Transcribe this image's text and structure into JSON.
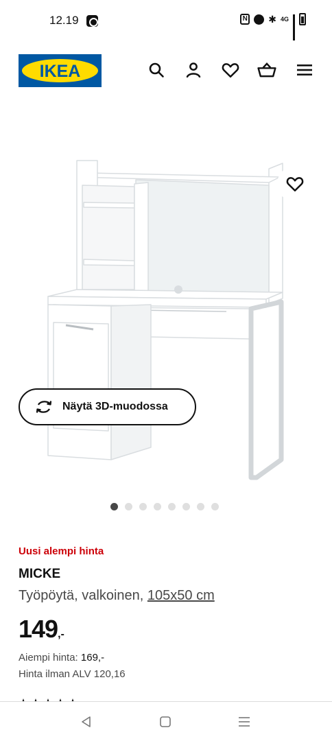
{
  "status_bar": {
    "time": "12.19",
    "network_label": "4G",
    "icons": [
      "app-notification-icon",
      "nfc-icon",
      "alarm-icon",
      "bluetooth-icon",
      "signal-icon",
      "battery-icon"
    ]
  },
  "header": {
    "logo_text": "IKEA",
    "icons": [
      "search-icon",
      "account-icon",
      "favourites-icon",
      "shopping-bag-icon",
      "menu-icon"
    ]
  },
  "gallery": {
    "view_3d_label": "Näytä 3D-muodossa",
    "dot_count": 8,
    "active_dot": 0
  },
  "product": {
    "badge": "Uusi alempi hinta",
    "name": "MICKE",
    "description": "Työpöytä, valkoinen, ",
    "size": "105x50 cm",
    "price_integer": "149",
    "price_decimal": ",-",
    "previous_price_label": "Aiempi hinta: ",
    "previous_price_value": "169,-",
    "price_excl_vat": "Hinta ilman ALV 120,16"
  },
  "colors": {
    "brand_blue": "#0058a3",
    "brand_yellow": "#ffdb00",
    "badge_red": "#cc0008"
  }
}
